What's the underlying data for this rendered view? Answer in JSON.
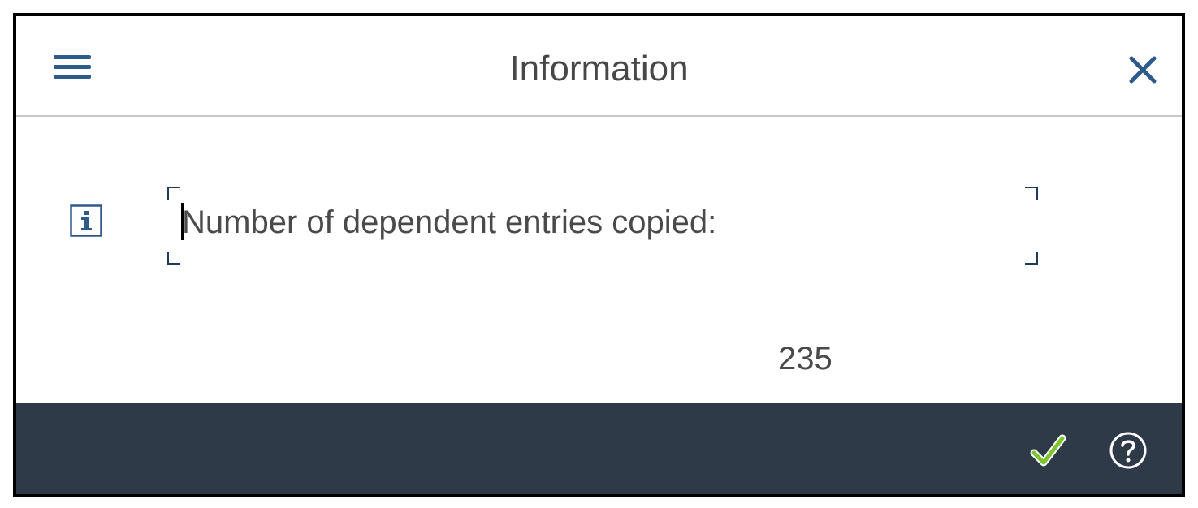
{
  "dialog": {
    "title": "Information",
    "message": "Number of dependent entries copied:",
    "value": "235"
  },
  "header": {
    "menu_icon": "hamburger-menu-icon",
    "close_icon": "close-icon"
  },
  "footer": {
    "ok_icon": "checkmark-icon",
    "help_icon": "help-icon"
  },
  "colors": {
    "footer_bg": "#2f3a48",
    "accent": "#2d5a8a",
    "check_green": "#7bc62d",
    "text": "#4a4a4a"
  }
}
